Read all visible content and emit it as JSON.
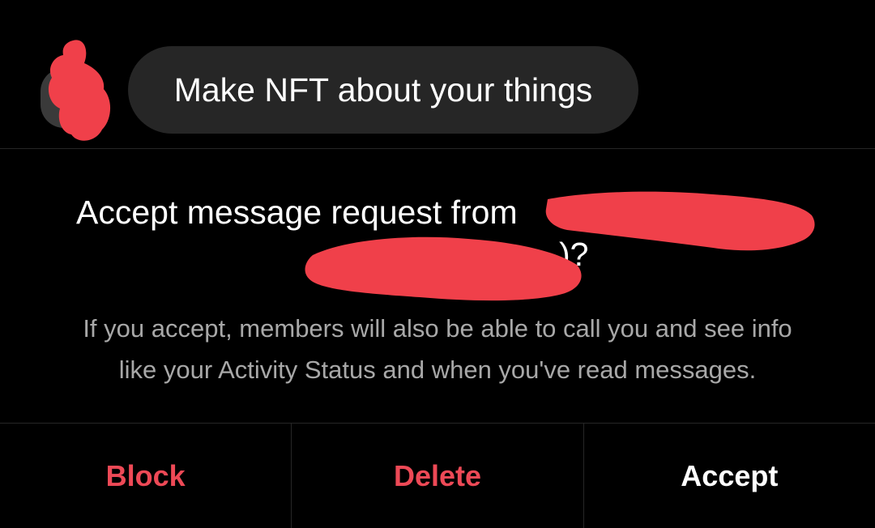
{
  "message": {
    "text": "Make NFT about your things"
  },
  "request": {
    "title_line1": "Accept message request from",
    "title_line2": ")?",
    "info_line1": "If you accept, members will also be able to call you and see info",
    "info_line2": "like your Activity Status and when you've read messages."
  },
  "actions": {
    "block_label": "Block",
    "delete_label": "Delete",
    "accept_label": "Accept"
  },
  "colors": {
    "background": "#000000",
    "bubble": "#262626",
    "danger": "#ed4956",
    "secondary_text": "#a8a8a8",
    "redaction": "#f0404a"
  }
}
